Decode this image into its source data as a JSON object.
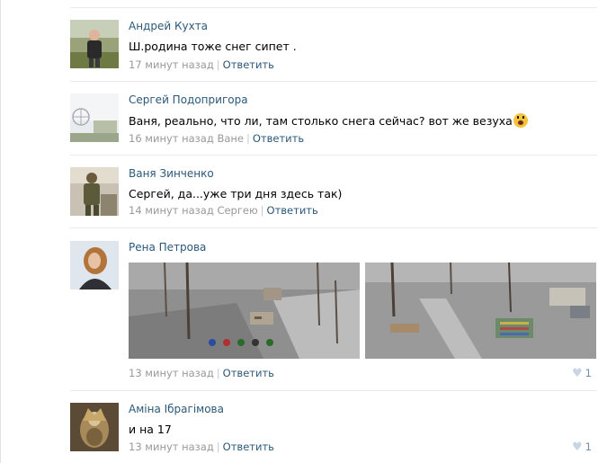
{
  "comments": [
    {
      "author": "Андрей Кухта",
      "text": "Ш.родина тоже снег сипет .",
      "time": "17 минут назад",
      "address_to": "",
      "reply_label": "Ответить",
      "likes": ""
    },
    {
      "author": "Сергей Подопригора",
      "text": "Ваня, реально, что ли, там столько снега сейчас? вот же везуха",
      "time": "16 минут назад",
      "address_to": "Ване",
      "reply_label": "Ответить",
      "likes": ""
    },
    {
      "author": "Ваня Зинченко",
      "text": "Сергей, да...уже три дня здесь так)",
      "time": "14 минут назад",
      "address_to": "Сергею",
      "reply_label": "Ответить",
      "likes": ""
    },
    {
      "author": "Рена Петрова",
      "text": "",
      "time": "13 минут назад",
      "address_to": "",
      "reply_label": "Ответить",
      "likes": "1"
    },
    {
      "author": "Аміна Ібрагімова",
      "text": "и на 17",
      "time": "13 минут назад",
      "address_to": "",
      "reply_label": "Ответить",
      "likes": "1"
    }
  ],
  "icons": {
    "emoji": "screaming-face-emoji",
    "like": "heart-icon"
  },
  "colors": {
    "link": "#2b587a",
    "meta": "#999999",
    "divider": "#e7eaee",
    "like_count": "#6d8fb3"
  }
}
